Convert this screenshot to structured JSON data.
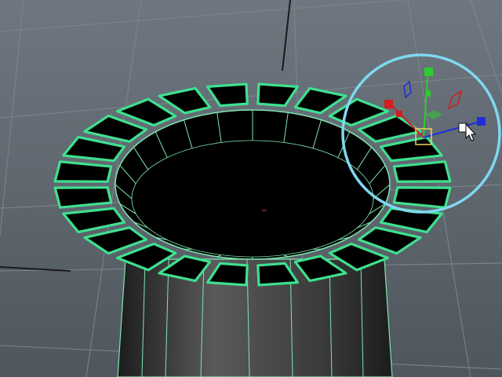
{
  "viewport": {
    "background_top": "#6e7780",
    "background_bottom": "#4f565d",
    "grid_color": "#7d858d",
    "grid_axis_color": "#1a1a1a"
  },
  "mesh": {
    "selection_color": "#3fe08f",
    "wire_color": "#7fe6b0",
    "face_fill": "#000000",
    "cylinder_light": "#5a5a5a",
    "cylinder_dark": "#1c1c1c",
    "extruded_face_count": 24,
    "shell_face_count": 24
  },
  "manipulator": {
    "tool": "universal-manipulator",
    "ring_color": "#7fd8f0",
    "x_axis_color": "#d21e1e",
    "y_axis_color": "#2ecc2e",
    "z_axis_color": "#1f2fd6",
    "center_box_color": "#f0d060",
    "cursor_icon": "arrow-cursor-icon"
  }
}
